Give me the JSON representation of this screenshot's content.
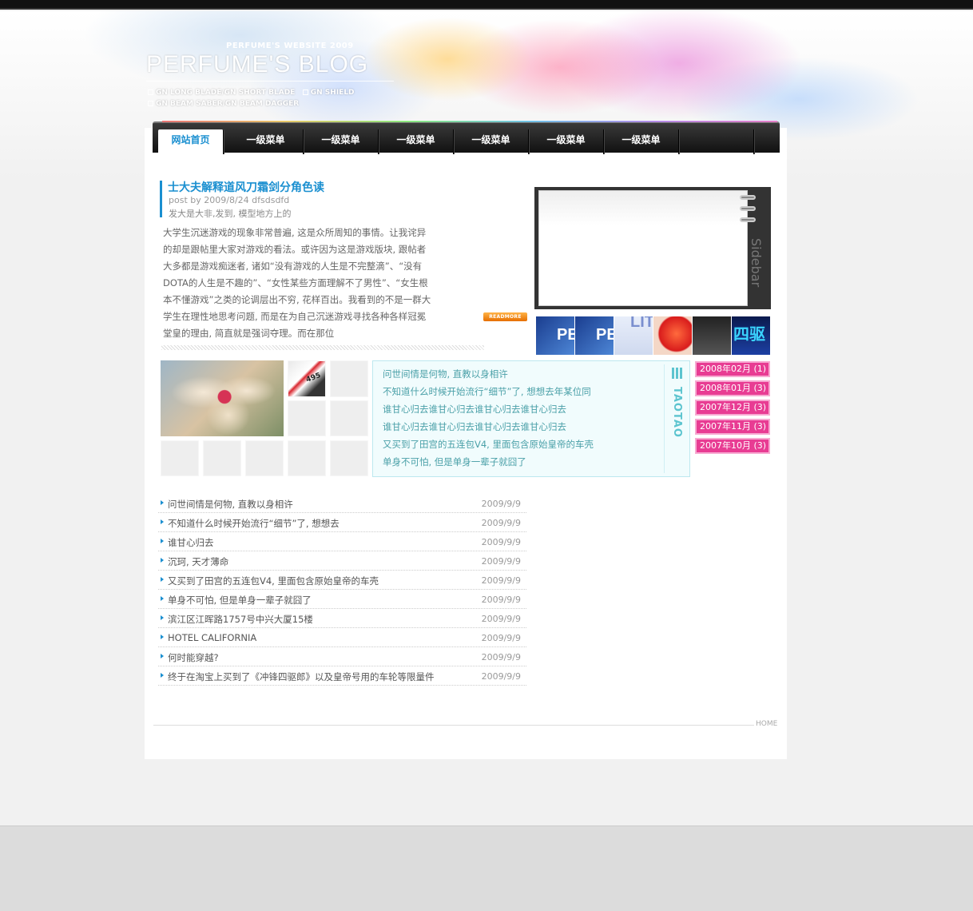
{
  "header": {
    "subtitle": "PERFUME'S WEBSITE 2009",
    "title": "PERFUME'S BLOG",
    "tagline_1": "GN LONG BLADE/GN SHORT BLADE",
    "tagline_2": "GN SHIELD",
    "tagline_3": "GN BEAM SABER/GN BEAM DAGGER"
  },
  "nav": {
    "items": [
      {
        "label": "网站首页",
        "active": true
      },
      {
        "label": "一级菜单",
        "active": false
      },
      {
        "label": "一级菜单",
        "active": false
      },
      {
        "label": "一级菜单",
        "active": false
      },
      {
        "label": "一级菜单",
        "active": false
      },
      {
        "label": "一级菜单",
        "active": false
      },
      {
        "label": "一级菜单",
        "active": false
      }
    ]
  },
  "post": {
    "title": "士大夫解释道风刀霜剑分角色读",
    "meta": "post by 2009/8/24 dfsdsdfd",
    "summary": "发大是大非,发到, 模型地方上的",
    "body": "大学生沉迷游戏的现象非常普遍, 这是众所周知的事情。让我诧异的却是跟帖里大家对游戏的看法。或许因为这是游戏版块, 跟帖者大多都是游戏痴迷者, 诸如“没有游戏的人生是不完整滴”、“没有DOTA的人生是不趣的”、“女性某些方面理解不了男性”、“女生根本不懂游戏”之类的论调层出不穷, 花样百出。我看到的不是一群大学生在理性地思考问题, 而是在为自己沉迷游戏寻找各种各样冠冕堂皇的理由, 简直就是强词夺理。而在那位",
    "readmore": "READMORE"
  },
  "viewer": {
    "side_label": "Sidebar",
    "thumbs": [
      "PE",
      "PE",
      "LIT",
      "",
      "",
      "四驱"
    ]
  },
  "gallery": {
    "badge": "495"
  },
  "notes": {
    "tag": "TAOTAO",
    "lines": [
      "问世间情是何物, 直教以身相许",
      "不知道什么时候开始流行“细节”了, 想想去年某位同",
      "谁甘心归去谁甘心归去谁甘心归去谁甘心归去",
      "谁甘心归去谁甘心归去谁甘心归去谁甘心归去",
      "又买到了田宫的五连包V4, 里面包含原始皇帝的车壳",
      "单身不可怕, 但是单身一辈子就囧了"
    ]
  },
  "archive": {
    "items": [
      "2008年02月 (1)",
      "2008年01月 (3)",
      "2007年12月 (3)",
      "2007年11月 (3)",
      "2007年10月 (3)"
    ]
  },
  "list": {
    "items": [
      {
        "title": "问世间情是何物, 直教以身相许",
        "date": "2009/9/9"
      },
      {
        "title": "不知道什么时候开始流行“细节”了, 想想去",
        "date": "2009/9/9"
      },
      {
        "title": "谁甘心归去",
        "date": "2009/9/9"
      },
      {
        "title": "沉珂, 天才薄命",
        "date": "2009/9/9"
      },
      {
        "title": "又买到了田宫的五连包V4, 里面包含原始皇帝的车壳",
        "date": "2009/9/9"
      },
      {
        "title": "单身不可怕, 但是单身一辈子就囧了",
        "date": "2009/9/9"
      },
      {
        "title": "滨江区江晖路1757号中兴大厦15楼",
        "date": "2009/9/9"
      },
      {
        "title": "HOTEL CALIFORNIA",
        "date": "2009/9/9"
      },
      {
        "title": "何时能穿越?",
        "date": "2009/9/9"
      },
      {
        "title": "终于在淘宝上买到了《冲锋四驱郎》以及皇帝号用的车轮等限量件",
        "date": "2009/9/9"
      }
    ]
  },
  "footer": {
    "home": "HOME"
  },
  "colors": {
    "accent": "#1a8fd0",
    "archive_pink": "#e83c93",
    "notes_teal": "#4aa0a8"
  }
}
